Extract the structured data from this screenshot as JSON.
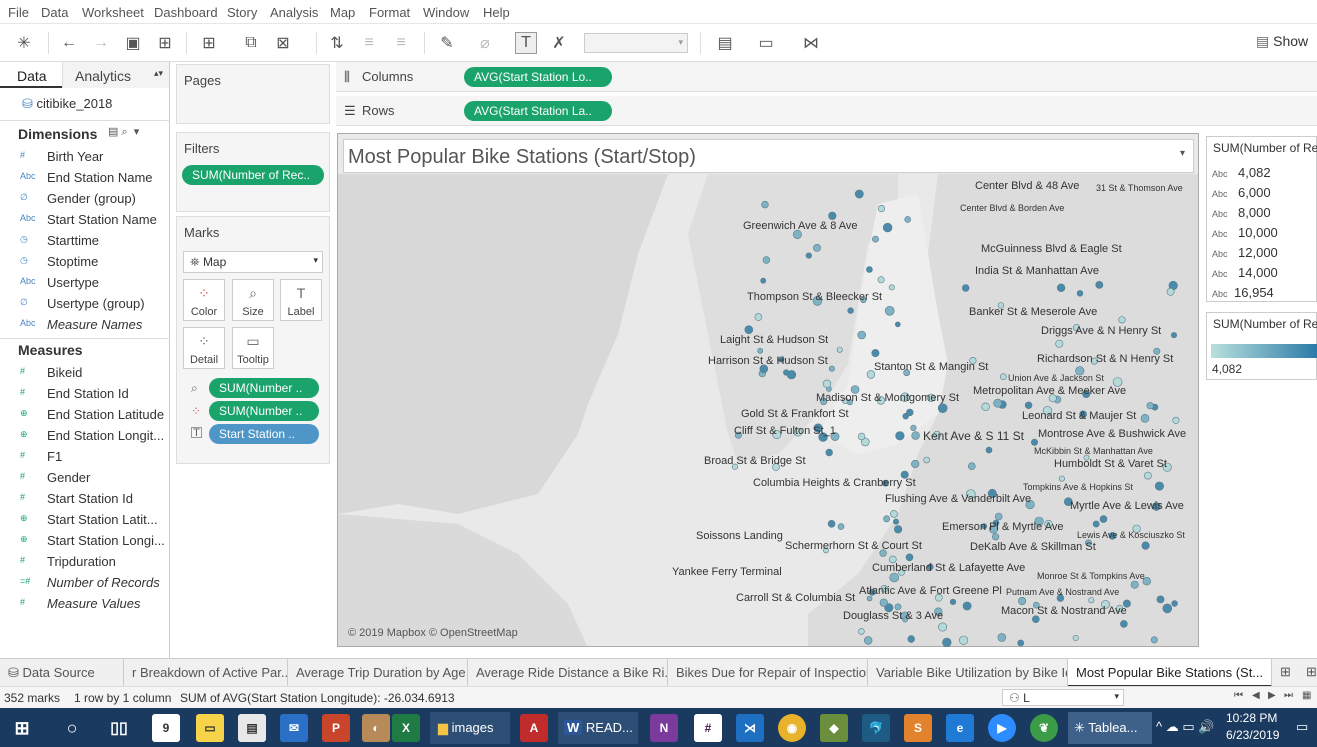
{
  "menu": [
    "File",
    "Data",
    "Worksheet",
    "Dashboard",
    "Story",
    "Analysis",
    "Map",
    "Format",
    "Window",
    "Help"
  ],
  "toolbar": {
    "show_me_label": "Show"
  },
  "left_pane": {
    "tab_data": "Data",
    "tab_analytics": "Analytics",
    "datasource": "citibike_2018",
    "dimensions_title": "Dimensions",
    "dimensions": [
      {
        "icon": "#",
        "label": "Birth Year"
      },
      {
        "icon": "Abc",
        "label": "End Station Name"
      },
      {
        "icon": "∅",
        "label": "Gender (group)"
      },
      {
        "icon": "Abc",
        "label": "Start Station Name"
      },
      {
        "icon": "◷",
        "label": "Starttime"
      },
      {
        "icon": "◷",
        "label": "Stoptime"
      },
      {
        "icon": "Abc",
        "label": "Usertype"
      },
      {
        "icon": "∅",
        "label": "Usertype (group)"
      },
      {
        "icon": "Abc",
        "label": "Measure Names"
      }
    ],
    "measures_title": "Measures",
    "measures": [
      {
        "icon": "#",
        "label": "Bikeid"
      },
      {
        "icon": "#",
        "label": "End Station Id"
      },
      {
        "icon": "⊕",
        "label": "End Station Latitude"
      },
      {
        "icon": "⊕",
        "label": "End Station Longit..."
      },
      {
        "icon": "#",
        "label": "F1"
      },
      {
        "icon": "#",
        "label": "Gender"
      },
      {
        "icon": "#",
        "label": "Start Station Id"
      },
      {
        "icon": "⊕",
        "label": "Start Station Latit..."
      },
      {
        "icon": "⊕",
        "label": "Start Station Longi..."
      },
      {
        "icon": "#",
        "label": "Tripduration"
      },
      {
        "icon": "=#",
        "label": "Number of Records"
      },
      {
        "icon": "#",
        "label": "Measure Values"
      }
    ]
  },
  "shelves": {
    "pages_title": "Pages",
    "filters_title": "Filters",
    "filter_pill": "SUM(Number of Rec..",
    "marks_title": "Marks",
    "mark_type": "Map",
    "mark_buttons": [
      "Color",
      "Size",
      "Label",
      "Detail",
      "Tooltip"
    ],
    "mark_pills": [
      "SUM(Number ..",
      "SUM(Number ..",
      "Start Station .."
    ],
    "columns_label": "Columns",
    "columns_pill": "AVG(Start Station Lo..",
    "rows_label": "Rows",
    "rows_pill": "AVG(Start Station La.."
  },
  "viz": {
    "title": "Most Popular Bike Stations (Start/Stop)",
    "attribution": "© 2019 Mapbox © OpenStreetMap",
    "labels": [
      "Center Blvd & 48 Ave",
      "31 St & Thomson Ave",
      "Center Blvd & Borden Ave",
      "Greenwich Ave & 8 Ave",
      "McGuinness Blvd & Eagle St",
      "India St & Manhattan Ave",
      "Thompson St & Bleecker St",
      "Banker St & Meserole Ave",
      "Driggs Ave & N Henry St",
      "Laight St & Hudson St",
      "Richardson St & N Henry St",
      "Harrison St & Hudson St",
      "Stanton St & Mangin St",
      "Union Ave & Jackson St",
      "Metropolitan Ave & Meeker Ave",
      "Madison St & Montgomery St",
      "Gold St & Frankfort St",
      "Leonard St & Maujer St",
      "Cliff St & Fulton St_1",
      "Kent Ave & S 11 St",
      "Montrose Ave & Bushwick Ave",
      "McKibbin St & Manhattan Ave",
      "Broad St & Bridge St",
      "Humboldt St & Varet St",
      "Columbia Heights & Cranberry St",
      "Tompkins Ave & Hopkins St",
      "Flushing Ave & Vanderbilt Ave",
      "Myrtle Ave & Lewis Ave",
      "Emerson Pl & Myrtle Ave",
      "Lewis Ave & Kosciuszko St",
      "Soissons Landing",
      "Schermerhorn St & Court St",
      "DeKalb Ave & Skillman St",
      "Cumberland St & Lafayette Ave",
      "Yankee Ferry Terminal",
      "Monroe St & Tompkins Ave",
      "Atlantic Ave & Fort Greene Pl",
      "Putnam Ave & Nostrand Ave",
      "Carroll St & Columbia St",
      "Macon St & Nostrand Ave",
      "Douglass St & 3 Ave"
    ]
  },
  "legends": {
    "size_title": "SUM(Number of Re",
    "size_items": [
      "4,082",
      "6,000",
      "8,000",
      "10,000",
      "12,000",
      "14,000",
      "16,954"
    ],
    "color_title": "SUM(Number of Re",
    "color_min": "4,082"
  },
  "sheet_tabs": [
    "Data Source",
    "r Breakdown of Active Par...",
    "Average Trip Duration by Age",
    "Average Ride Distance a Bike Ri...",
    "Bikes Due for Repair of Inspection",
    "Variable Bike Utilization by Bike Id",
    "Most Popular Bike Stations (St..."
  ],
  "status": {
    "marks": "352 marks",
    "rows_cols": "1 row by 1 column",
    "sum": "SUM of AVG(Start Station Longitude): -26.034.6913",
    "user": "L"
  },
  "taskbar": {
    "apps": [
      "images",
      "READ...",
      "Tablea..."
    ],
    "time": "10:28 PM",
    "date": "6/23/2019"
  },
  "colors": {
    "pill_green": "#1aa36b",
    "pill_blue": "#4f96c8",
    "taskbar": "#1b3a5f"
  }
}
